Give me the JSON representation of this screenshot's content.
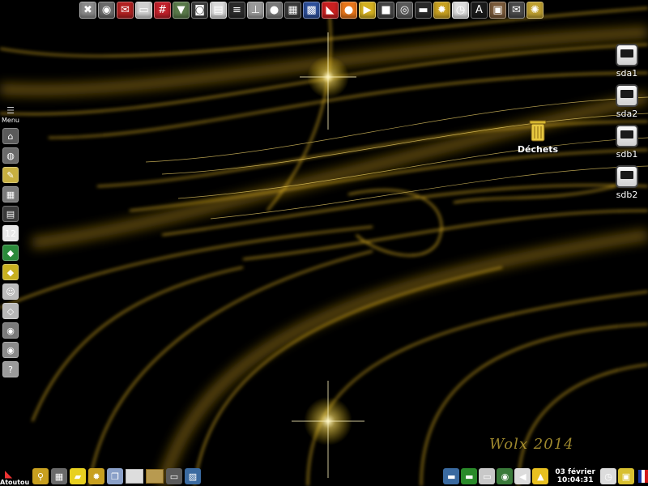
{
  "desktop": {
    "watermark": "Wolx 2014",
    "trash": {
      "label": "Déchets",
      "icon": "trash-icon"
    },
    "drives": [
      {
        "label": "sda1",
        "icon": "hard-drive-icon"
      },
      {
        "label": "sda2",
        "icon": "hard-drive-icon"
      },
      {
        "label": "sdb1",
        "icon": "hard-drive-icon"
      },
      {
        "label": "sdb2",
        "icon": "hard-drive-icon"
      }
    ]
  },
  "top_launcher": [
    {
      "icon": "tools-icon",
      "glyph": "✖",
      "color": "#8a8a8a"
    },
    {
      "icon": "package-icon",
      "glyph": "◉",
      "color": "#6b6b6b"
    },
    {
      "icon": "mail-icon",
      "glyph": "✉",
      "color": "#b22222"
    },
    {
      "icon": "disk-icon",
      "glyph": "▭",
      "color": "#d0d0d0"
    },
    {
      "icon": "network-grid-icon",
      "glyph": "#",
      "color": "#c0202a"
    },
    {
      "icon": "install-box-icon",
      "glyph": "▼",
      "color": "#5a7a4a"
    },
    {
      "icon": "camera-icon",
      "glyph": "◙",
      "color": "#3a3a3a"
    },
    {
      "icon": "notes-icon",
      "glyph": "▤",
      "color": "#d8d8d8"
    },
    {
      "icon": "hierarchy-icon",
      "glyph": "≡",
      "color": "#2a2a2a"
    },
    {
      "icon": "usb-icon",
      "glyph": "⊥",
      "color": "#9a9a9a"
    },
    {
      "icon": "webcam-icon",
      "glyph": "●",
      "color": "#7a7a7a"
    },
    {
      "icon": "film-strip-icon",
      "glyph": "▦",
      "color": "#3a3a3a"
    },
    {
      "icon": "calendar-grid-icon",
      "glyph": "▩",
      "color": "#2d4f9a"
    },
    {
      "icon": "burn-disc-icon",
      "glyph": "◣",
      "color": "#c82020"
    },
    {
      "icon": "media-player-icon",
      "glyph": "●",
      "color": "#e8761a"
    },
    {
      "icon": "play-icon",
      "glyph": "▶",
      "color": "#d4b020"
    },
    {
      "icon": "video-camera-icon",
      "glyph": "■",
      "color": "#444444"
    },
    {
      "icon": "optical-disc-icon",
      "glyph": "◎",
      "color": "#5a5a5a"
    },
    {
      "icon": "monitor-icon",
      "glyph": "▬",
      "color": "#2a2a2a"
    },
    {
      "icon": "settings-gear-icon",
      "glyph": "✹",
      "color": "#c8a020"
    },
    {
      "icon": "clock-icon",
      "glyph": "◷",
      "color": "#dcdcdc"
    },
    {
      "icon": "font-icon",
      "glyph": "A",
      "color": "#1a1a1a"
    },
    {
      "icon": "archive-box-icon",
      "glyph": "▣",
      "color": "#7a5a3a"
    },
    {
      "icon": "email-icon",
      "glyph": "✉",
      "color": "#4a4a4a"
    },
    {
      "icon": "gear-emblem-icon",
      "glyph": "✺",
      "color": "#bfa030"
    }
  ],
  "left_dock": {
    "menu_label": "Menu",
    "items": [
      {
        "icon": "home-icon",
        "glyph": "⌂",
        "color": "#5a5a5a"
      },
      {
        "icon": "globe-icon",
        "glyph": "◍",
        "color": "#6a6a6a"
      },
      {
        "icon": "document-edit-icon",
        "glyph": "✎",
        "color": "#c8b040"
      },
      {
        "icon": "calculator-icon",
        "glyph": "▦",
        "color": "#7a7a7a"
      },
      {
        "icon": "film-clapper-icon",
        "glyph": "▤",
        "color": "#3a3a3a"
      },
      {
        "icon": "calendar-icon",
        "glyph": "12",
        "color": "#e8e8e8"
      },
      {
        "icon": "wifi-network-icon",
        "glyph": "◆",
        "color": "#2a8a3a"
      },
      {
        "icon": "direction-sign-icon",
        "glyph": "◆",
        "color": "#c8b020"
      },
      {
        "icon": "chat-faces-icon",
        "glyph": "☺",
        "color": "#bcbcbc"
      },
      {
        "icon": "box-icon",
        "glyph": "◇",
        "color": "#b8b8b8"
      },
      {
        "icon": "package-manager-icon",
        "glyph": "◉",
        "color": "#7a7a7a"
      },
      {
        "icon": "gnu-icon",
        "glyph": "◉",
        "color": "#8a8a8a"
      },
      {
        "icon": "help-icon",
        "glyph": "?",
        "color": "#9a9a9a"
      }
    ]
  },
  "taskbar": {
    "start_label": "Atoutou",
    "launchers": [
      {
        "icon": "search-icon",
        "glyph": "⚲",
        "color": "#c8a020"
      },
      {
        "icon": "calculator-icon",
        "glyph": "▦",
        "color": "#6a6a6a"
      },
      {
        "icon": "sticky-note-icon",
        "glyph": "▰",
        "color": "#e8d020"
      },
      {
        "icon": "settings-gear-icon",
        "glyph": "✹",
        "color": "#c8a020"
      },
      {
        "icon": "windows-icon",
        "glyph": "❐",
        "color": "#8aa0c8"
      }
    ],
    "tray": [
      {
        "icon": "monitor-network-icon",
        "glyph": "▬",
        "color": "#3a6aa0"
      },
      {
        "icon": "network-status-icon",
        "glyph": "▬",
        "color": "#2a8a2a"
      },
      {
        "icon": "clipboard-icon",
        "glyph": "▭",
        "color": "#c8c8c8"
      },
      {
        "icon": "network-manager-icon",
        "glyph": "◉",
        "color": "#3a7a3a"
      },
      {
        "icon": "volume-icon",
        "glyph": "◀",
        "color": "#dcdcdc"
      },
      {
        "icon": "update-notifier-icon",
        "glyph": "▲",
        "color": "#e8c020"
      }
    ],
    "clock": {
      "date": "03 février",
      "time": "10:04:31"
    },
    "tray_right": [
      {
        "icon": "clock-icon",
        "glyph": "◷",
        "color": "#dcdcdc"
      },
      {
        "icon": "lock-icon",
        "glyph": "▣",
        "color": "#d8c030"
      }
    ],
    "language_flag": "french-flag-icon"
  }
}
